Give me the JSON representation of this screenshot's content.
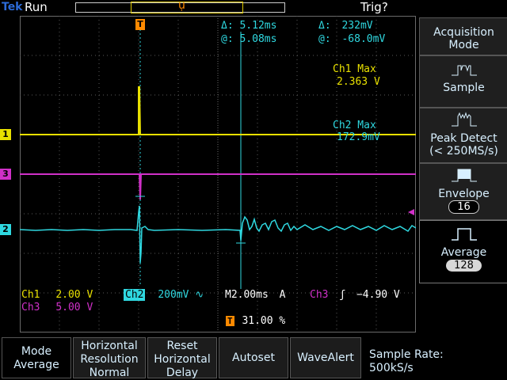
{
  "header": {
    "brand": "Tek",
    "run_state": "Run",
    "trigger_status": "Trig?",
    "trigger_position_marker": "ụ"
  },
  "cursors": {
    "delta_time_label": "Δ:",
    "delta_time": "5.12ms",
    "delta_volt_label": "Δ:",
    "delta_volt": "232mV",
    "at_time_label": "@:",
    "at_time": "5.08ms",
    "at_volt_label": "@:",
    "at_volt": "-68.0mV"
  },
  "measurements": {
    "ch1_max_label": "Ch1 Max",
    "ch1_max_value": "2.363 V",
    "ch2_max_label": "Ch2 Max",
    "ch2_max_value": "172.9mV"
  },
  "channels": {
    "ch1_marker": "1",
    "ch2_marker": "2",
    "ch3_marker": "3",
    "trigger_marker": "T"
  },
  "status": {
    "ch1_label": "Ch1",
    "ch1_scale": "2.00 V",
    "ch2_label": "Ch2",
    "ch2_scale": "200mV",
    "ch2_bw_symbol": "∿",
    "ch3_label": "Ch3",
    "ch3_scale": "5.00 V",
    "timebase": "M2.00ms",
    "trigger_source_label": "A",
    "trigger_channel": "Ch3",
    "trigger_slope_symbol": "ʃ",
    "trigger_level": "−4.90 V",
    "trigger_position_icon": "T",
    "trigger_position": "31.00 %"
  },
  "side_menu": {
    "title_line1": "Acquisition",
    "title_line2": "Mode",
    "items": [
      {
        "label": "Sample",
        "icon": "sample-waveform-icon"
      },
      {
        "label": "Peak Detect",
        "sublabel": "(< 250MS/s)",
        "icon": "peak-detect-waveform-icon"
      },
      {
        "label": "Envelope",
        "value": "16",
        "icon": "envelope-waveform-icon"
      },
      {
        "label": "Average",
        "value": "128",
        "icon": "average-waveform-icon"
      }
    ]
  },
  "bottom_menu": {
    "items": [
      {
        "line1": "Mode",
        "line2": "Average"
      },
      {
        "line1": "Horizontal",
        "line2": "Resolution",
        "line3": "Normal"
      },
      {
        "line1": "Reset",
        "line2": "Horizontal",
        "line3": "Delay"
      },
      {
        "line1": "Autoset"
      },
      {
        "line1": "WaveAlert"
      }
    ],
    "sample_rate_label": "Sample Rate:",
    "sample_rate_value": "500kS/s"
  },
  "colors": {
    "ch1": "#e8e000",
    "ch2": "#2fd8e0",
    "ch3": "#d030c8",
    "trigger": "#ff8a00",
    "grid": "#5a5a5a"
  }
}
